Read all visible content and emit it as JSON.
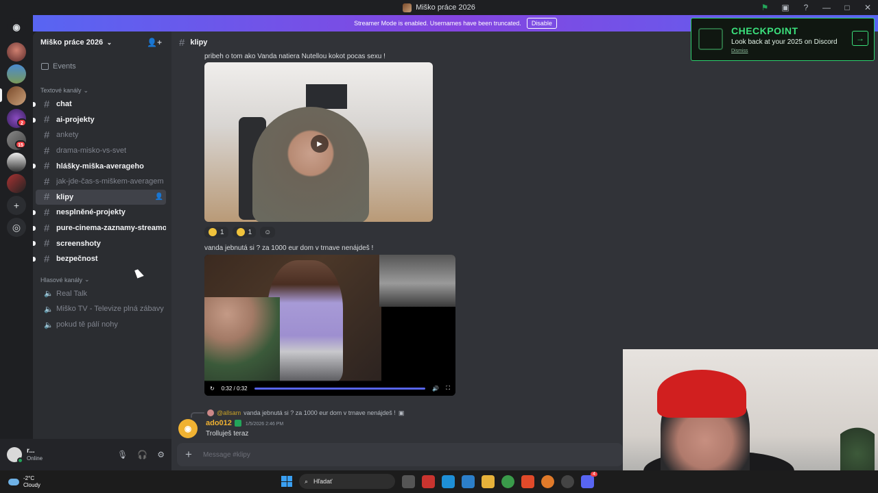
{
  "window": {
    "title": "Miško práce 2026"
  },
  "banner": {
    "text": "Streamer Mode is enabled. Usernames have been truncated.",
    "button": "Disable"
  },
  "server": {
    "name": "Miško práce 2026",
    "events_label": "Events",
    "text_category": "Textové kanály",
    "voice_category": "Hlasové kanály",
    "text_channels": [
      {
        "name": "chat",
        "state": "unread"
      },
      {
        "name": "ai-projekty",
        "state": "unread"
      },
      {
        "name": "ankety",
        "state": "read"
      },
      {
        "name": "drama-misko-vs-svet",
        "state": "read"
      },
      {
        "name": "hlášky-miška-averageho",
        "state": "unread"
      },
      {
        "name": "jak-jde-čas-s-miškem-averagem",
        "state": "read"
      },
      {
        "name": "klipy",
        "state": "active"
      },
      {
        "name": "nesplněné-projekty",
        "state": "unread"
      },
      {
        "name": "pure-cinema-zaznamy-streamov",
        "state": "unread"
      },
      {
        "name": "screenshoty",
        "state": "unread"
      },
      {
        "name": "bezpečnost",
        "state": "unread"
      }
    ],
    "voice_channels": [
      "Real Talk",
      "Miško TV - Televize plná zábavy",
      "pokud tě pálí nohy"
    ],
    "guild_badges": [
      "2",
      "15"
    ]
  },
  "user": {
    "name": "r...",
    "status": "Online"
  },
  "channel": {
    "name": "klipy"
  },
  "messages": {
    "msg1_text": "pribeh o tom ako Vanda natiera Nutellou kokot pocas sexu !",
    "reactions": [
      {
        "emoji": "rofl",
        "count": "1"
      },
      {
        "emoji": "tired",
        "count": "1"
      }
    ],
    "msg2_text": "vanda jebnutá si ? za 1000 eur dom v trnave nenájdeš !",
    "video_time": "0:32 / 0:32",
    "video_progress": 1.0,
    "reply_mention": "@allsam",
    "reply_text": "vanda jebnutá si ? za 1000 eur dom v trnave nenájdeš !",
    "author": "ado012",
    "timestamp": "1/5/2026 2:46 PM",
    "body": "Trolluješ teraz"
  },
  "composer": {
    "placeholder": "Message #klipy"
  },
  "checkpoint": {
    "title": "CHECKPOINT",
    "subtitle": "Look back at your 2025 on Discord",
    "dismiss": "Dismiss"
  },
  "taskbar": {
    "temp": "-2°C",
    "weather": "Cloudy",
    "search": "Hľadať",
    "discord_badge": "4"
  },
  "colors": {
    "blurple": "#5865f2",
    "online": "#23a55a",
    "checkpoint_green": "#3be27d"
  }
}
